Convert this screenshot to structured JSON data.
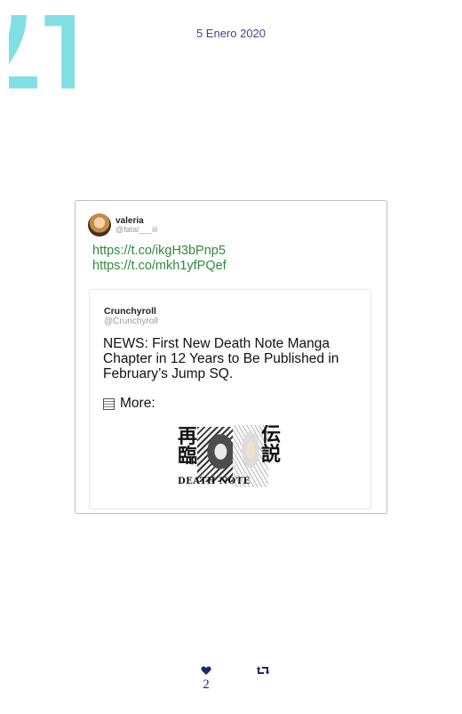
{
  "page": {
    "number": "17",
    "date": "5 Enero 2020",
    "accent_color": "#7fdfe3"
  },
  "tweet": {
    "author_name": "valeria",
    "author_handle": "@fatal___iii",
    "links": [
      "https://t.co/ikgH3bPnp5",
      "https://t.co/mkh1yfPQef"
    ],
    "link_color": "#2d8b3f"
  },
  "quoted_tweet": {
    "author_name": "Crunchyroll",
    "author_handle": "@Crunchyroll",
    "text": "NEWS: First New Death Note Manga Chapter in 12 Years to Be Published in February’s Jump SQ.",
    "more_label": "More:",
    "more_icon": "newspaper-icon",
    "media_kanji_left": "再臨",
    "media_kanji_right": "伝説",
    "media_title": "DEATH NOTE"
  },
  "stats": {
    "likes": "2",
    "like_icon": "heart-icon",
    "retweet_icon": "retweet-icon",
    "icon_color": "#1a2a6c"
  }
}
